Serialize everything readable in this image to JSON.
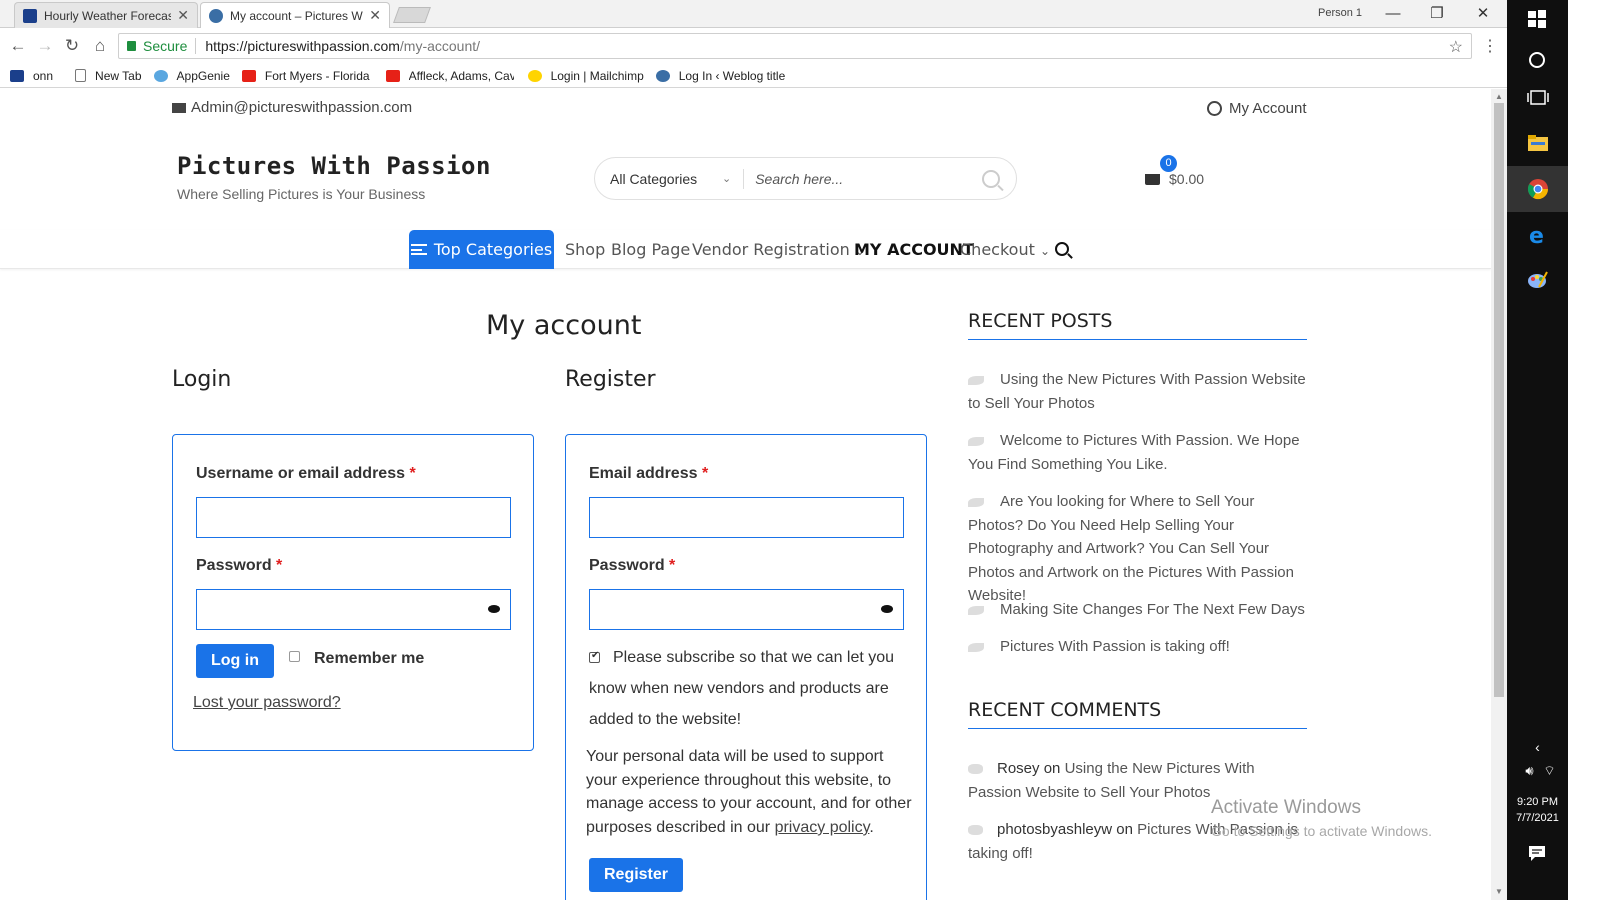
{
  "browser": {
    "tabs": [
      {
        "title": "Hourly Weather Forecast",
        "active": false
      },
      {
        "title": "My account – Pictures W",
        "active": true
      }
    ],
    "profile": "Person 1",
    "security_label": "Secure",
    "url_host": "https://pictureswithpassion.com",
    "url_path": "/my-account/",
    "bookmarks": [
      "onn",
      "New Tab",
      "AppGenie",
      "Fort Myers - Florida",
      "Affleck, Adams, Cavi",
      "Login | Mailchimp",
      "Log In ‹ Weblog title"
    ]
  },
  "site": {
    "admin_email": "Admin@pictureswithpassion.com",
    "my_account_link": "My Account",
    "title": "Pictures With Passion",
    "tagline": "Where Selling Pictures is Your Business",
    "search": {
      "category": "All Categories",
      "placeholder": "Search here..."
    },
    "cart": {
      "count": "0",
      "total": "$0.00"
    },
    "nav": {
      "top_categories": "Top Categories",
      "items": [
        "Shop",
        "Blog Page",
        "Vendor Registration",
        "MY ACCOUNT",
        "Checkout"
      ]
    }
  },
  "main": {
    "page_title": "My account",
    "login": {
      "heading": "Login",
      "username_label": "Username or email address",
      "password_label": "Password",
      "required": "*",
      "login_button": "Log in",
      "remember_me": "Remember me",
      "lost_password": "Lost your password?"
    },
    "register": {
      "heading": "Register",
      "email_label": "Email address",
      "password_label": "Password",
      "required": "*",
      "subscribe_text_1": "Please subscribe so that we can let you",
      "subscribe_text_2": "know when new vendors and products are",
      "subscribe_text_3": "added to the website!",
      "privacy_1": "Your personal data will be used to support",
      "privacy_2": "your experience throughout this website, to",
      "privacy_3": "manage access to your account, and for other",
      "privacy_4": "purposes described in our",
      "privacy_link": "privacy policy",
      "privacy_end": ".",
      "register_button": "Register"
    }
  },
  "sidebar": {
    "recent_posts_heading": "RECENT POSTS",
    "recent_posts": [
      "Using the New Pictures With Passion Website to Sell Your Photos",
      "Welcome to Pictures With Passion. We Hope You Find Something You Like.",
      "Are You looking for Where to Sell Your Photos? Do You Need Help Selling Your Photography and Artwork? You Can Sell Your Photos and Artwork on the Pictures With Passion Website!",
      "Making Site Changes For The Next Few Days",
      "Pictures With Passion is taking off!"
    ],
    "recent_comments_heading": "RECENT COMMENTS",
    "recent_comments": [
      {
        "author": "Rosey",
        "on": "on",
        "post": "Using the New Pictures With Passion Website to Sell Your Photos"
      },
      {
        "author": "photosbyashleyw",
        "on": "on",
        "post": "Pictures With Passion is taking off!"
      }
    ]
  },
  "watermark": {
    "line1": "Activate Windows",
    "line2": "Go to Settings to activate Windows."
  },
  "taskbar": {
    "time": "9:20 PM",
    "date": "7/7/2021"
  },
  "colors": {
    "accent": "#1a73e8",
    "required": "#e01e1e"
  }
}
